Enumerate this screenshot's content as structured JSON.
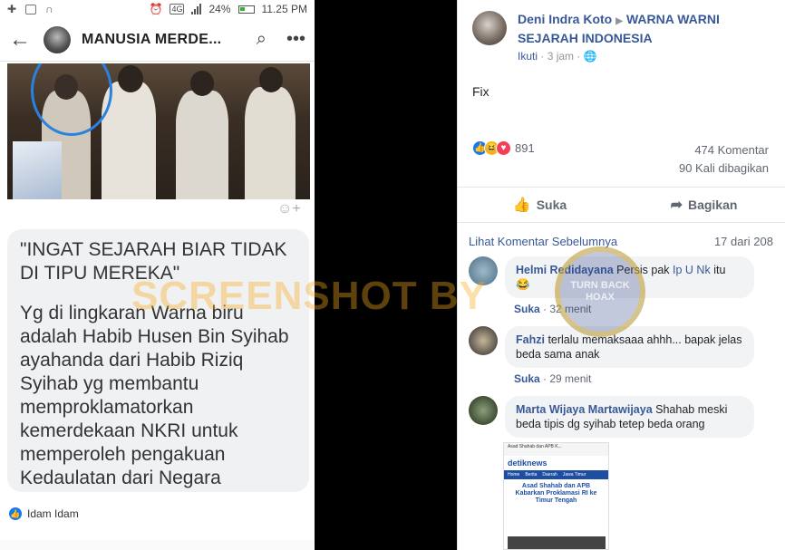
{
  "phone": {
    "status": {
      "battery": "24%",
      "time": "11.25 PM",
      "network": "4G"
    },
    "header": {
      "title": "MANUSIA MERDE..."
    },
    "message_quote": "\"INGAT SEJARAH BIAR TIDAK DI TIPU MEREKA\"",
    "message_body": "Yg di lingkaran Warna biru adalah Habib Husen Bin Syihab ayahanda dari Habib Riziq Syihab yg membantu memproklamatorkan kemerdekaan NKRI untuk memperoleh pengakuan Kedaulatan dari Negara",
    "reactor_name": "Idam Idam"
  },
  "post": {
    "author": "Deni Indra Koto",
    "group": "WARNA WARNI SEJARAH INDONESIA",
    "follow_label": "Ikuti",
    "time": "3 jam",
    "text": "Fix",
    "reaction_count": "891",
    "comments_count": "474 Komentar",
    "shares_count": "90 Kali dibagikan",
    "like_label": "Suka",
    "share_label": "Bagikan",
    "prev_comments_label": "Lihat Komentar Sebelumnya",
    "comments_position": "17 dari 208"
  },
  "comments": [
    {
      "name": "Helmi Redidayana",
      "text": "Persis pak",
      "tag": "Ip U Nk",
      "text_after": "itu",
      "emoji": "😂",
      "like": "Suka",
      "time": "32 menit"
    },
    {
      "name": "Fahzi",
      "text": "terlalu memaksaaa ahhh... bapak jelas beda sama anak",
      "like": "Suka",
      "time": "29 menit"
    },
    {
      "name": "Marta Wijaya Martawijaya",
      "text": "Shahab meski beda tipis dg syihab tetep beda orang"
    }
  ],
  "shared_article": {
    "top": "Asad Shahab dan APB K...",
    "logo": "detiknews",
    "nav": [
      "Home",
      "Berita",
      "Daerah",
      "Jawa Timur"
    ],
    "headline": "Asad Shahab dan APB Kabarkan Proklamasi RI ke Timur Tengah"
  },
  "watermark": {
    "text": "SCREENSHOT BY",
    "seal": "TURN BACK HOAX"
  },
  "colors": {
    "fb_blue": "#385898",
    "like_blue": "#1877f2",
    "watermark": "#f7aa1e"
  }
}
